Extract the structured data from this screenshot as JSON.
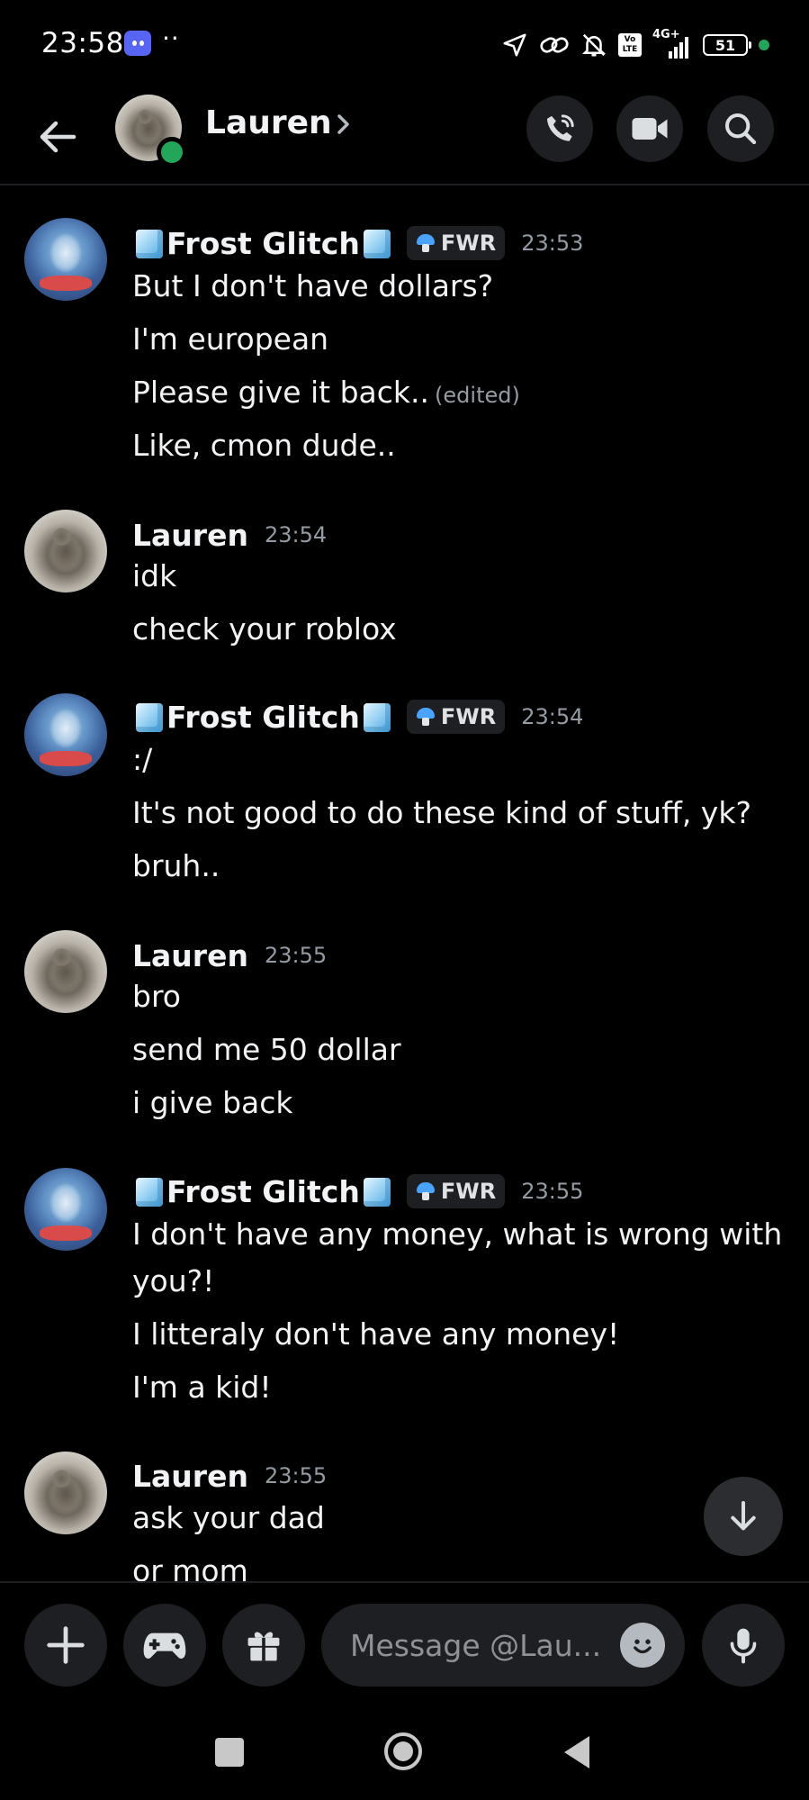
{
  "status_bar": {
    "time": "23:58",
    "dots": "··",
    "network": "4G+",
    "volte": "Vo LTE",
    "battery": "51"
  },
  "header": {
    "contact_name": "Lauren",
    "online_color": "#23a55a"
  },
  "frost": {
    "name": "Frost Glitch",
    "tag": "FWR"
  },
  "messages": [
    {
      "author": "frost",
      "time": "23:53",
      "lines": [
        "But I don't have dollars?",
        "I'm european",
        "Please give it back..",
        "Like, cmon dude.."
      ],
      "edited_label": "(edited)"
    },
    {
      "author": "Lauren",
      "time": "23:54",
      "lines": [
        "idk",
        "check your roblox"
      ]
    },
    {
      "author": "frost",
      "time": "23:54",
      "lines": [
        ":/",
        "It's not good to do these kind of stuff, yk?",
        "bruh.."
      ]
    },
    {
      "author": "Lauren",
      "time": "23:55",
      "lines": [
        "bro",
        "send me 50 dollar",
        "i give back"
      ]
    },
    {
      "author": "frost",
      "time": "23:55",
      "lines": [
        "I don't have any money, what is wrong with",
        "you?!",
        "I litteraly don't have any money!",
        "I'm a kid!"
      ]
    },
    {
      "author": "Lauren",
      "time": "23:55",
      "lines": [
        "ask your dad",
        "or mom"
      ]
    }
  ],
  "composer": {
    "placeholder": "Message @Lau..."
  },
  "colors": {
    "background": "#000000",
    "surface": "#1e1f22",
    "text": "#f2f3f5",
    "muted": "#949ba4",
    "blurple": "#5865f2"
  }
}
